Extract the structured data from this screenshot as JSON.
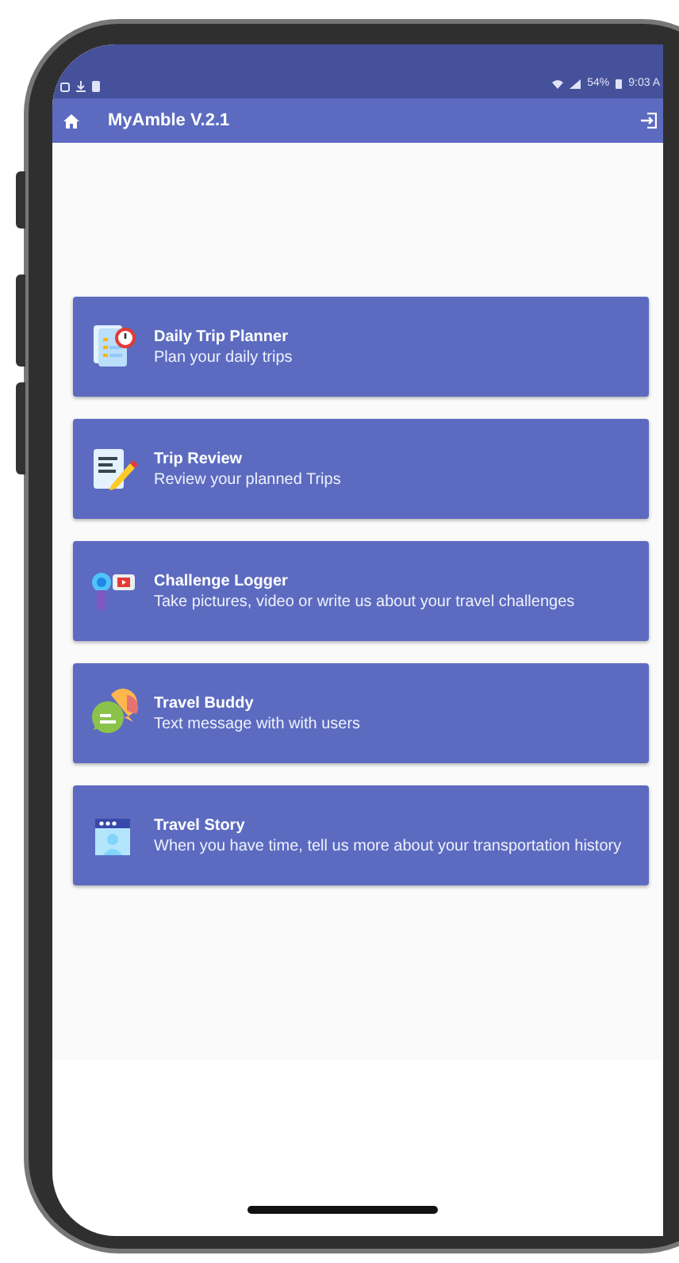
{
  "status_bar": {
    "battery": "54%",
    "time": "9:03 A"
  },
  "app_bar": {
    "title": "MyAmble V.2.1"
  },
  "menu": [
    {
      "title": "Daily Trip Planner",
      "subtitle": "Plan your daily trips"
    },
    {
      "title": "Trip Review",
      "subtitle": "Review your planned Trips"
    },
    {
      "title": "Challenge Logger",
      "subtitle": "Take pictures, video or write us about your travel challenges"
    },
    {
      "title": "Travel Buddy",
      "subtitle": "Text message with with users"
    },
    {
      "title": "Travel Story",
      "subtitle": "When you have time, tell us more about your transportation history"
    }
  ]
}
